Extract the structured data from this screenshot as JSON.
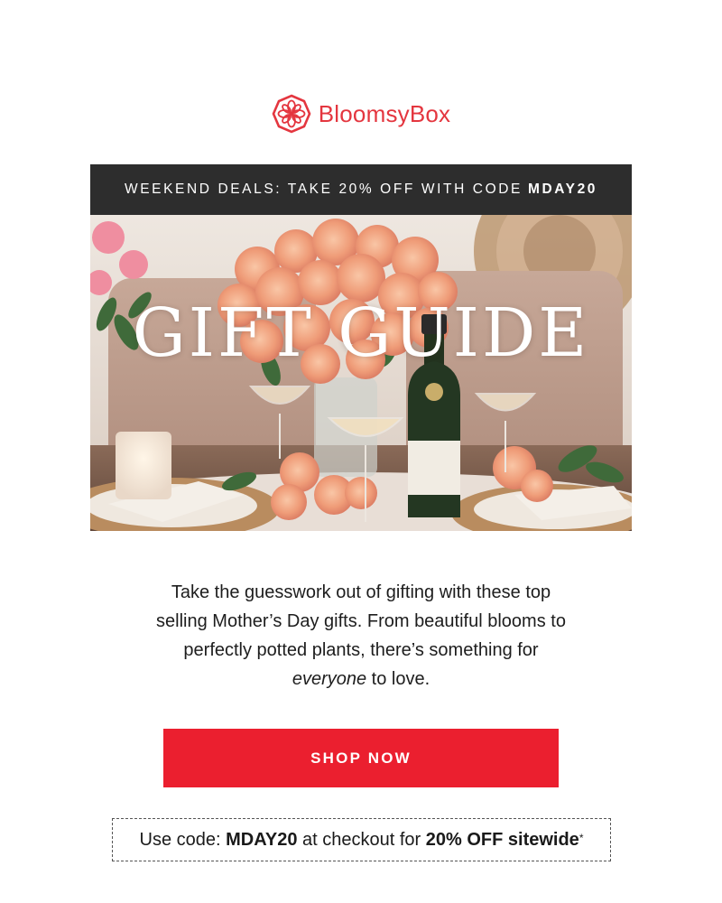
{
  "brand": {
    "name": "BloomsyBox",
    "color": "#e4363f",
    "logo_icon": "flower-badge-icon"
  },
  "promo_bar": {
    "text": "WEEKEND DEALS: TAKE 20% OFF WITH CODE",
    "code": "MDAY20",
    "background": "#2d2d2d"
  },
  "hero": {
    "title": "GIFT GUIDE",
    "image": "roses-champagne-table-photo"
  },
  "body": {
    "line_before": "Take the guesswork out of gifting with these top selling Mother’s Day gifts. From beautiful blooms to perfectly potted plants, there’s something for",
    "emphasis": "everyone",
    "line_after": "to love."
  },
  "cta": {
    "label": "SHOP NOW",
    "color": "#eb1f2f"
  },
  "code_box": {
    "prefix": "Use code:",
    "code": "MDAY20",
    "middle": "at checkout for",
    "offer": "20% OFF sitewide",
    "asterisk": "*"
  }
}
